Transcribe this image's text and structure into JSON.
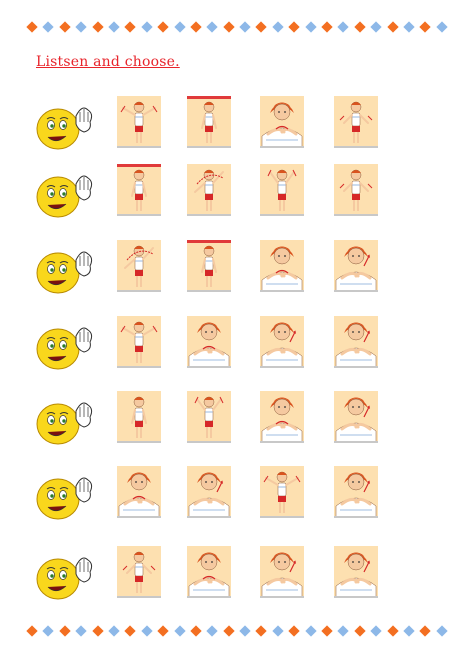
{
  "worksheet": {
    "title": "Listsen and choose.",
    "border_colors": [
      "#f36f21",
      "#8db8e8"
    ],
    "rows": [
      {
        "smiley": "listening-smiley-icon",
        "cards": [
          {
            "kind": "arms-wide",
            "redbar": false
          },
          {
            "kind": "arms-down",
            "redbar": true
          },
          {
            "kind": "closeup-chest",
            "redbar": false
          },
          {
            "kind": "arms-out-arrows",
            "redbar": false
          }
        ]
      },
      {
        "smiley": "listening-smiley-icon",
        "cards": [
          {
            "kind": "arms-down",
            "redbar": true
          },
          {
            "kind": "twist",
            "redbar": false
          },
          {
            "kind": "arms-up-arrows",
            "redbar": false
          },
          {
            "kind": "arms-out-arrows",
            "redbar": false
          }
        ]
      },
      {
        "smiley": "listening-smiley-icon",
        "cards": [
          {
            "kind": "twist",
            "redbar": false
          },
          {
            "kind": "arms-down",
            "redbar": true
          },
          {
            "kind": "closeup-chest",
            "redbar": false
          },
          {
            "kind": "closeup-arrow",
            "redbar": false
          }
        ]
      },
      {
        "smiley": "listening-smiley-icon",
        "cards": [
          {
            "kind": "arms-wide",
            "redbar": false
          },
          {
            "kind": "closeup-chest",
            "redbar": false
          },
          {
            "kind": "closeup-arrow",
            "redbar": false
          },
          {
            "kind": "closeup-arrow",
            "redbar": false
          }
        ]
      },
      {
        "smiley": "listening-smiley-icon",
        "cards": [
          {
            "kind": "arms-down",
            "redbar": false
          },
          {
            "kind": "arms-up-arrows",
            "redbar": false
          },
          {
            "kind": "closeup-chest",
            "redbar": false
          },
          {
            "kind": "closeup-arrow",
            "redbar": false
          }
        ]
      },
      {
        "smiley": "listening-smiley-icon",
        "cards": [
          {
            "kind": "closeup-chest",
            "redbar": false
          },
          {
            "kind": "closeup-arrow",
            "redbar": false
          },
          {
            "kind": "arms-wide",
            "redbar": false
          },
          {
            "kind": "closeup-arrow",
            "redbar": false
          }
        ]
      },
      {
        "smiley": "listening-smiley-icon",
        "cards": [
          {
            "kind": "arms-out-arrows",
            "redbar": false
          },
          {
            "kind": "closeup-chest",
            "redbar": false
          },
          {
            "kind": "closeup-arrow",
            "redbar": false
          },
          {
            "kind": "closeup-arrow",
            "redbar": false
          }
        ]
      }
    ]
  }
}
